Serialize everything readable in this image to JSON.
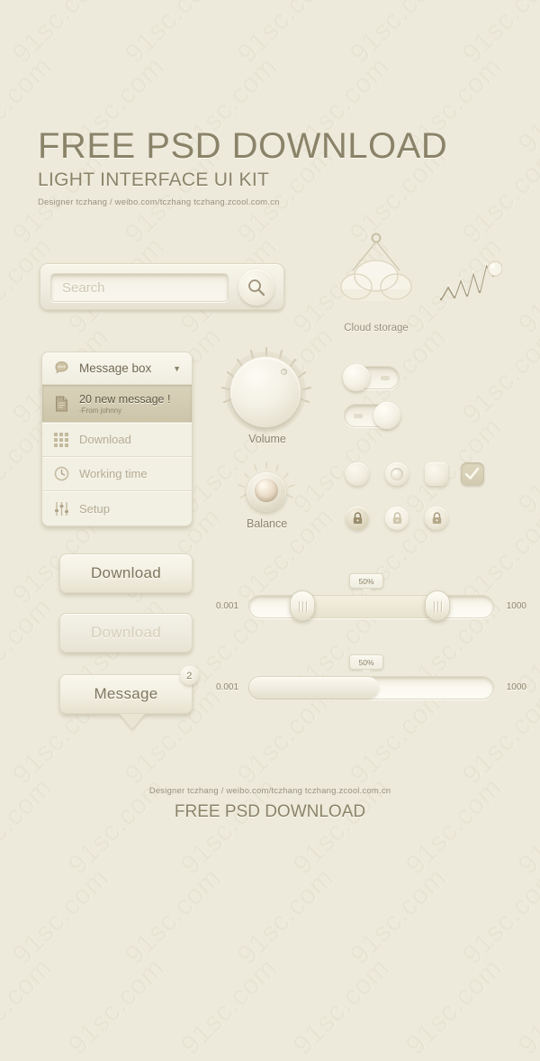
{
  "meta": {
    "background_color": "#edeadb",
    "accent_color": "#8b8369",
    "watermark_text": "91sc.com"
  },
  "header": {
    "title": "FREE PSD DOWNLOAD",
    "subtitle": "LIGHT INTERFACE UI KIT",
    "credit": "Designer  tczhang  /  weibo.com/tczhang    tczhang.zcool.com.cn"
  },
  "search": {
    "placeholder": "Search",
    "icon": "search-icon"
  },
  "cloud": {
    "label": "Cloud storage",
    "icon": "cloud-icon"
  },
  "pulse": {
    "icon": "line-chart-icon"
  },
  "menu": {
    "header": {
      "label": "Message box",
      "icon": "chat-bubble-icon",
      "caret": "▼"
    },
    "items": [
      {
        "label": "20 new message !",
        "sublabel": "-From johnny",
        "icon": "document-icon",
        "state": "active"
      },
      {
        "label": "Download",
        "sublabel": "",
        "icon": "grid-icon",
        "state": "normal"
      },
      {
        "label": "Working time",
        "sublabel": "",
        "icon": "clock-icon",
        "state": "normal"
      },
      {
        "label": "Setup",
        "sublabel": "",
        "icon": "sliders-icon",
        "state": "normal"
      }
    ]
  },
  "knobs": [
    {
      "label": "Volume",
      "type": "large"
    },
    {
      "label": "Balance",
      "type": "small"
    }
  ],
  "toggles": [
    {
      "name": "toggle-off",
      "state": "off"
    },
    {
      "name": "toggle-on",
      "state": "on"
    }
  ],
  "controls": [
    {
      "name": "radio-unchecked",
      "shape": "round",
      "checked": false
    },
    {
      "name": "radio-checked",
      "shape": "round",
      "checked": true
    },
    {
      "name": "checkbox-unchecked",
      "shape": "square",
      "checked": false
    },
    {
      "name": "checkbox-checked",
      "shape": "square",
      "checked": true
    }
  ],
  "locks": [
    {
      "name": "lock-button-dark",
      "icon": "lock-icon",
      "variant": "dark"
    },
    {
      "name": "lock-button-light",
      "icon": "lock-icon",
      "variant": "light"
    },
    {
      "name": "lock-button-mid",
      "icon": "lock-icon",
      "variant": "mid"
    }
  ],
  "buttons": {
    "download_active": "Download",
    "download_disabled": "Download",
    "message": "Message",
    "message_badge": "2"
  },
  "sliders": [
    {
      "name": "range-slider",
      "min_label": "0.001",
      "max_label": "1000",
      "tooltip": "50%",
      "handle_left_pct": 14,
      "handle_right_pct": 72
    },
    {
      "name": "progress-slider",
      "min_label": "0.001",
      "max_label": "1000",
      "tooltip": "50%",
      "fill_pct": 53
    }
  ],
  "footer": {
    "credit": "Designer  tczhang  /  weibo.com/tczhang    tczhang.zcool.com.cn",
    "title": "FREE PSD DOWNLOAD"
  }
}
